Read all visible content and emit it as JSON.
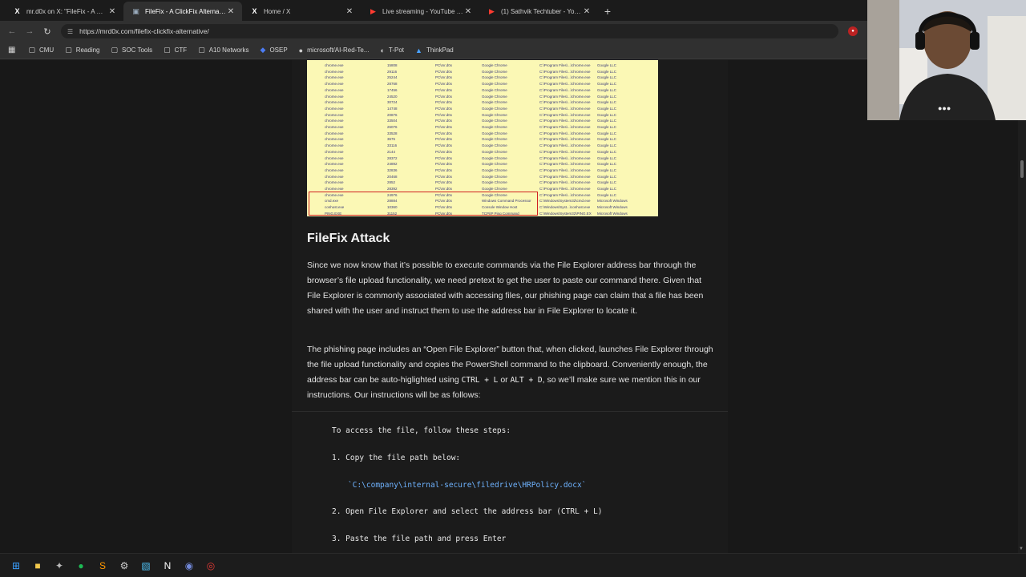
{
  "tabs": [
    {
      "title": "mr.d0x on X: \"FileFix - A ClickFi",
      "icon": "x-logo-icon",
      "active": false
    },
    {
      "title": "FileFix - A ClickFix Alternative |",
      "icon": "page-icon",
      "active": true
    },
    {
      "title": "Home / X",
      "icon": "x-logo-icon",
      "active": false
    },
    {
      "title": "Live streaming - YouTube Studi",
      "icon": "youtube-icon",
      "active": false
    },
    {
      "title": "(1) Sathvik Techtuber - YouTube",
      "icon": "youtube-icon",
      "active": false
    }
  ],
  "newtab_label": "+",
  "url": "https://mrd0x.com/filefix-clickfix-alternative/",
  "bookmarks": [
    {
      "label": "CMU",
      "icon": "folder-icon"
    },
    {
      "label": "Reading",
      "icon": "folder-icon"
    },
    {
      "label": "SOC Tools",
      "icon": "folder-icon"
    },
    {
      "label": "CTF",
      "icon": "folder-icon"
    },
    {
      "label": "A10 Networks",
      "icon": "folder-icon"
    },
    {
      "label": "OSEP",
      "icon": "osep-icon"
    },
    {
      "label": "microsoft/AI-Red-Te...",
      "icon": "github-icon"
    },
    {
      "label": "T-Pot",
      "icon": "tpot-icon"
    },
    {
      "label": "ThinkPad",
      "icon": "thinkpad-icon"
    }
  ],
  "article": {
    "heading": "FileFix Attack",
    "para1": "Since we now know that it’s possible to execute commands via the File Explorer address bar through the browser’s file upload functionality, we need pretext to get the user to paste our command there. Given that File Explorer is commonly associated with accessing files, our phishing page can claim that a file has been shared with the user and instruct them to use the address bar in File Explorer to locate it.",
    "para2_a": "The phishing page includes an “Open File Explorer” button that, when clicked, launches File Explorer through the file upload functionality and copies the PowerShell command to the clipboard. Conveniently enough, the address bar can be auto-higlighted using ",
    "para2_code1": "CTRL + L",
    "para2_or": " or ",
    "para2_code2": "ALT + D",
    "para2_b": ", so we’ll make sure we mention this in our instructions. Our instructions will be as follows:",
    "code_heading": "To access the file, follow these steps:",
    "step1": "1. Copy the file path below:",
    "path": "`C:\\company\\internal-secure\\filedrive\\HRPolicy.docx`",
    "step2": "2. Open File Explorer and select the address bar (CTRL + L)",
    "step3": "3. Paste the file path and press Enter"
  },
  "process_rows": [
    [
      "chrome.exe",
      "15808",
      "PC\\mr.d0x",
      "Google Chrome",
      "C:\\Program Files\\...\\chrome.exe",
      "Google LLC"
    ],
    [
      "chrome.exe",
      "29116",
      "PC\\mr.d0x",
      "Google Chrome",
      "C:\\Program Files\\...\\chrome.exe",
      "Google LLC"
    ],
    [
      "chrome.exe",
      "25244",
      "PC\\mr.d0x",
      "Google Chrome",
      "C:\\Program Files\\...\\chrome.exe",
      "Google LLC"
    ],
    [
      "chrome.exe",
      "28768",
      "PC\\mr.d0x",
      "Google Chrome",
      "C:\\Program Files\\...\\chrome.exe",
      "Google LLC"
    ],
    [
      "chrome.exe",
      "17456",
      "PC\\mr.d0x",
      "Google Chrome",
      "C:\\Program Files\\...\\chrome.exe",
      "Google LLC"
    ],
    [
      "chrome.exe",
      "24520",
      "PC\\mr.d0x",
      "Google Chrome",
      "C:\\Program Files\\...\\chrome.exe",
      "Google LLC"
    ],
    [
      "chrome.exe",
      "30724",
      "PC\\mr.d0x",
      "Google Chrome",
      "C:\\Program Files\\...\\chrome.exe",
      "Google LLC"
    ],
    [
      "chrome.exe",
      "14748",
      "PC\\mr.d0x",
      "Google Chrome",
      "C:\\Program Files\\...\\chrome.exe",
      "Google LLC"
    ],
    [
      "chrome.exe",
      "20876",
      "PC\\mr.d0x",
      "Google Chrome",
      "C:\\Program Files\\...\\chrome.exe",
      "Google LLC"
    ],
    [
      "chrome.exe",
      "33504",
      "PC\\mr.d0x",
      "Google Chrome",
      "C:\\Program Files\\...\\chrome.exe",
      "Google LLC"
    ],
    [
      "chrome.exe",
      "26076",
      "PC\\mr.d0x",
      "Google Chrome",
      "C:\\Program Files\\...\\chrome.exe",
      "Google LLC"
    ],
    [
      "chrome.exe",
      "33528",
      "PC\\mr.d0x",
      "Google Chrome",
      "C:\\Program Files\\...\\chrome.exe",
      "Google LLC"
    ],
    [
      "chrome.exe",
      "3676",
      "PC\\mr.d0x",
      "Google Chrome",
      "C:\\Program Files\\...\\chrome.exe",
      "Google LLC"
    ],
    [
      "chrome.exe",
      "33116",
      "PC\\mr.d0x",
      "Google Chrome",
      "C:\\Program Files\\...\\chrome.exe",
      "Google LLC"
    ],
    [
      "chrome.exe",
      "2144",
      "PC\\mr.d0x",
      "Google Chrome",
      "C:\\Program Files\\...\\chrome.exe",
      "Google LLC"
    ],
    [
      "chrome.exe",
      "28372",
      "PC\\mr.d0x",
      "Google Chrome",
      "C:\\Program Files\\...\\chrome.exe",
      "Google LLC"
    ],
    [
      "chrome.exe",
      "24892",
      "PC\\mr.d0x",
      "Google Chrome",
      "C:\\Program Files\\...\\chrome.exe",
      "Google LLC"
    ],
    [
      "chrome.exe",
      "32836",
      "PC\\mr.d0x",
      "Google Chrome",
      "C:\\Program Files\\...\\chrome.exe",
      "Google LLC"
    ],
    [
      "chrome.exe",
      "20468",
      "PC\\mr.d0x",
      "Google Chrome",
      "C:\\Program Files\\...\\chrome.exe",
      "Google LLC"
    ],
    [
      "chrome.exe",
      "2852",
      "PC\\mr.d0x",
      "Google Chrome",
      "C:\\Program Files\\...\\chrome.exe",
      "Google LLC"
    ],
    [
      "chrome.exe",
      "28392",
      "PC\\mr.d0x",
      "Google Chrome",
      "C:\\Program Files\\...\\chrome.exe",
      "Google LLC"
    ],
    [
      "chrome.exe",
      "24976",
      "PC\\mr.d0x",
      "Google Chrome",
      "C:\\Program Files\\...\\chrome.exe",
      "Google LLC"
    ],
    [
      "cmd.exe",
      "28884",
      "PC\\mr.d0x",
      "Windows Command Processor",
      "C:\\Windows\\System32\\cmd.exe",
      "Microsoft Windows"
    ],
    [
      "conhost.exe",
      "10360",
      "PC\\mr.d0x",
      "Console Window Host",
      "C:\\Windows\\Syst...\\conhost.exe",
      "Microsoft Windows"
    ],
    [
      "PING.EXE",
      "31152",
      "PC\\mr.d0x",
      "TCP/IP Ping Command",
      "C:\\Windows\\System32\\PING.EX",
      "Microsoft Windows"
    ]
  ],
  "taskbar": [
    {
      "icon": "windows-start-icon",
      "color": "#3aa0ff"
    },
    {
      "icon": "file-explorer-icon",
      "color": "#f2c94c"
    },
    {
      "icon": "app-icon",
      "color": "#bbbbbb"
    },
    {
      "icon": "spotify-icon",
      "color": "#1db954"
    },
    {
      "icon": "sublime-icon",
      "color": "#ff9800"
    },
    {
      "icon": "settings-icon",
      "color": "#cccccc"
    },
    {
      "icon": "snipping-icon",
      "color": "#4fc3f7"
    },
    {
      "icon": "notion-icon",
      "color": "#ffffff"
    },
    {
      "icon": "discord-icon",
      "color": "#7289da"
    },
    {
      "icon": "chrome-icon",
      "color": "#e53935"
    }
  ]
}
